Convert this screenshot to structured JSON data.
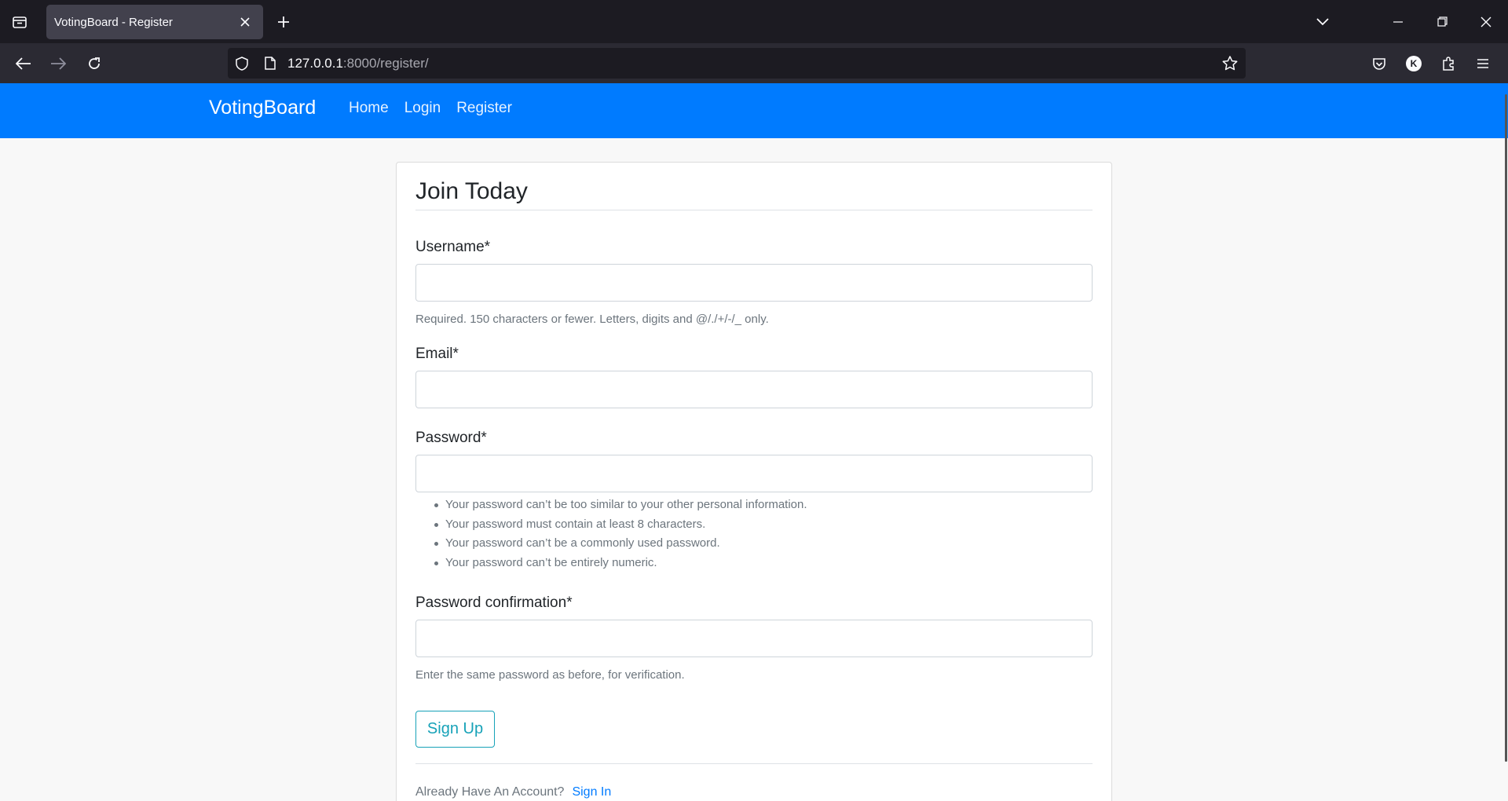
{
  "browser": {
    "tab_title": "VotingBoard - Register",
    "url_host": "127.0.0.1",
    "url_rest": ":8000/register/",
    "profile_initial": "K"
  },
  "site": {
    "brand": "VotingBoard",
    "nav": [
      "Home",
      "Login",
      "Register"
    ]
  },
  "form": {
    "title": "Join Today",
    "fields": {
      "username": {
        "label": "Username*",
        "value": "",
        "help": "Required. 150 characters or fewer. Letters, digits and @/./+/-/_ only."
      },
      "email": {
        "label": "Email*",
        "value": ""
      },
      "password": {
        "label": "Password*",
        "value": "",
        "help_items": [
          "Your password can’t be too similar to your other personal information.",
          "Your password must contain at least 8 characters.",
          "Your password can’t be a commonly used password.",
          "Your password can’t be entirely numeric."
        ]
      },
      "password_confirm": {
        "label": "Password confirmation*",
        "value": "",
        "help": "Enter the same password as before, for verification."
      }
    },
    "submit_label": "Sign Up",
    "footer_text": "Already Have An Account?",
    "footer_link": "Sign In"
  },
  "colors": {
    "navbar": "#007bff",
    "button_outline": "#17a2b8",
    "link": "#007bff"
  }
}
